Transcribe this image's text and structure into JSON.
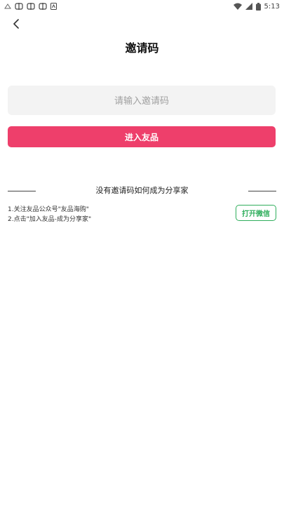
{
  "status_bar": {
    "time": "5:13",
    "left_icons": [
      "notification-icon",
      "notification-icon",
      "notification-icon",
      "notification-icon",
      "app-icon"
    ],
    "right_icons": [
      "wifi-icon",
      "signal-icon",
      "battery-icon"
    ]
  },
  "header": {
    "title": "邀请码"
  },
  "invite": {
    "input_placeholder": "请输入邀请码",
    "input_value": "",
    "submit_label": "进入友品"
  },
  "help": {
    "title": "没有邀请码如何成为分享家",
    "steps": [
      "1.关注友品公众号\"友品海购\"",
      "2.点击\"加入友品-成为分享家\""
    ],
    "wechat_button": "打开微信"
  },
  "colors": {
    "accent": "#ee3f6b",
    "wechat_green": "#2fae5c",
    "input_bg": "#f3f3f3"
  }
}
